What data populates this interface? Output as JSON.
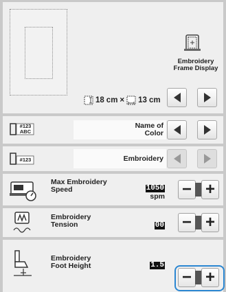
{
  "frame_display": {
    "label_line1": "Embroidery",
    "label_line2": "Frame Display",
    "width_value": "18",
    "width_unit": "cm",
    "times": "×",
    "height_value": "13",
    "height_unit": "cm"
  },
  "name_of_color": {
    "icon_text_line1": "#123",
    "icon_text_line2": "ABC",
    "label_line1": "Name of",
    "label_line2": "Color"
  },
  "embroidery_number": {
    "icon_text": "#123",
    "label": "Embroidery"
  },
  "max_speed": {
    "label_line1": "Max Embroidery",
    "label_line2": "Speed",
    "value": "1050",
    "unit": "spm"
  },
  "tension": {
    "label_line1": "Embroidery",
    "label_line2": "Tension",
    "value": "00"
  },
  "foot_height": {
    "label_line1": "Embroidery",
    "label_line2": "Foot Height",
    "value": "1.5"
  },
  "buttons": {
    "minus": "−",
    "plus": "+"
  },
  "colors": {
    "highlight": "#2a86d1",
    "panel": "#efefef",
    "background": "#c9c9c9"
  }
}
